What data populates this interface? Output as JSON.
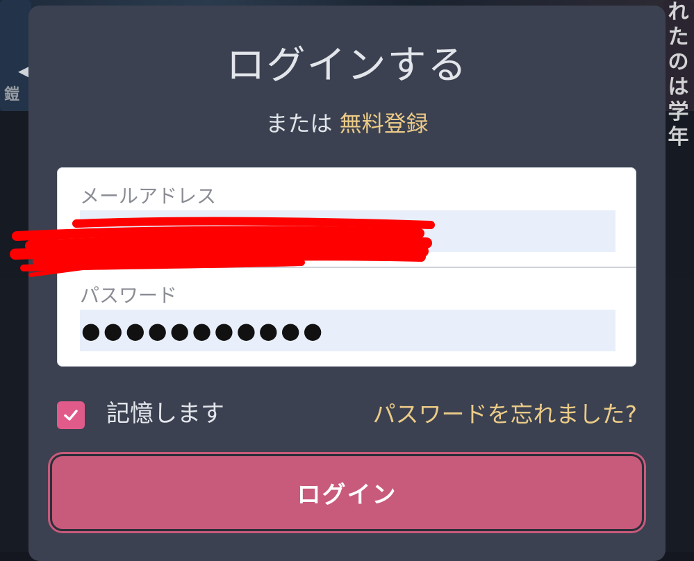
{
  "background": {
    "side_text_right": "れたのは学年",
    "side_text_left": "鎧"
  },
  "modal": {
    "title": "ログインする",
    "or_text": "または",
    "signup_link": "無料登録"
  },
  "form": {
    "email": {
      "label": "メールアドレス",
      "value": ""
    },
    "password": {
      "label": "パスワード",
      "masked_value": "●●●●●●●●●●●"
    }
  },
  "remember": {
    "label": "記憶します",
    "checked": true
  },
  "forgot_link": "パスワードを忘れました?",
  "login_button": "ログイン",
  "colors": {
    "modal_bg": "#3b4150",
    "accent_gold": "#eccb88",
    "button_pink": "#c85a7b",
    "checkbox_pink": "#e05a8a",
    "input_bg": "#e8effb",
    "redaction_red": "#ff0000"
  },
  "icons": {
    "checkbox": "checkmark-icon",
    "background_arrow": "chevron-left-icon"
  }
}
